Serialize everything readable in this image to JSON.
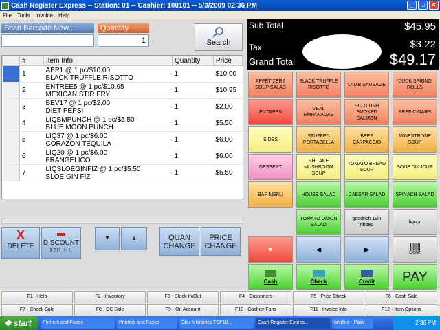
{
  "window": {
    "title": "Cash Register Express -- Station: 01 -- Cashier: 100101 -- 5/3/2009 02:36 PM"
  },
  "menu": [
    "File",
    "Tools",
    "Invoice",
    "Help"
  ],
  "scan": {
    "label": "Scan Barcode Now...",
    "value": ""
  },
  "quantity": {
    "label": "Quantity",
    "value": "1"
  },
  "search_label": "Search",
  "grid": {
    "headers": [
      "#",
      "Item Info",
      "Quantity",
      "Price"
    ],
    "rows": [
      {
        "n": "1",
        "line1": "APP1 @ 1 pc/$10.00",
        "line2": "BLACK TRUFFLE RISOTTO",
        "qty": "1",
        "price": "$10.00"
      },
      {
        "n": "2",
        "line1": "ENTREE5 @ 1 pc/$10.95",
        "line2": "MEXICAN STIR FRY",
        "qty": "1",
        "price": "$10.95"
      },
      {
        "n": "3",
        "line1": "BEV17 @ 1 pc/$2.00",
        "line2": "DIET PEPSI",
        "qty": "1",
        "price": "$2.00"
      },
      {
        "n": "4",
        "line1": "LIQBMPUNCH @ 1 pc/$5.50",
        "line2": "BLUE MOON PUNCH",
        "qty": "1",
        "price": "$5.50"
      },
      {
        "n": "5",
        "line1": "LIQ37 @ 1 pc/$6.00",
        "line2": "CORAZON TEQUILA",
        "qty": "1",
        "price": "$6.00"
      },
      {
        "n": "6",
        "line1": "LIQ20 @ 1 pc/$6.00",
        "line2": "FRANGELICO",
        "qty": "1",
        "price": "$6.00"
      },
      {
        "n": "7",
        "line1": "LIQSLOEGINFIZ @ 1 pc/$5.50",
        "line2": "SLOE GIN FIZ",
        "qty": "1",
        "price": "$5.50"
      }
    ]
  },
  "actions": {
    "delete": "DELETE",
    "discount": "DISCOUNT",
    "discount_sub": "Ctrl + L",
    "quan1": "QUAN",
    "quan2": "CHANGE",
    "price1": "PRICE",
    "price2": "CHANGE"
  },
  "totals": {
    "subtotal_label": "Sub Total",
    "subtotal": "$45.95",
    "tax_label": "Tax",
    "tax": "$3.22",
    "grand_label": "Grand Total",
    "grand": "$49.17"
  },
  "products": [
    "APPETIZERS SOUP SALAD",
    "BLACK TRUFFLE RISOTTO",
    "LAMB SAUSAGE",
    "DUCK SPRING ROLLS",
    "ENTREES",
    "VEAL EMPANADAS",
    "SCOTTISH SMOKED SALMON",
    "BEEF CIGARS",
    "SIDES",
    "STUFFED PORTABELLA",
    "BEEF CARPACCIO",
    "MINESTRONE SOUP",
    "DESSERT",
    "SHITAKE MUSHROOM SOUP",
    "TOMATO BREAD SOUP",
    "SOUP DU JOUR",
    "BAR MENU",
    "HOUSE SALAD",
    "CAESAR SALAD",
    "SPINACH SALAD",
    "TOMATO ONION SALAD",
    "goodrich 19in ribbed",
    "liquor"
  ],
  "tenders": {
    "done": "Done",
    "cash": "Cash",
    "check": "Check",
    "credit": "Credit",
    "pay": "PAY"
  },
  "fkeys": [
    "F1 - Help",
    "F2 - Inventory",
    "F3 - Clock In\\Out",
    "F4 - Customers",
    "F5 - Price Check",
    "F6 - Cash Sale",
    "F7 - Check Sale",
    "F8 - CC Sale",
    "F9 - On Account",
    "F10 - Cashier Fans",
    "F11 - Invoice Info",
    "F12 - Item Options"
  ],
  "taskbar": {
    "start": "start",
    "items": [
      "Printers and Faxes",
      "Printers and Faxes",
      "Star Micronics TSP10...",
      "Cash Register Expres...",
      "untitled - Paint"
    ],
    "clock": "2:36 PM"
  }
}
